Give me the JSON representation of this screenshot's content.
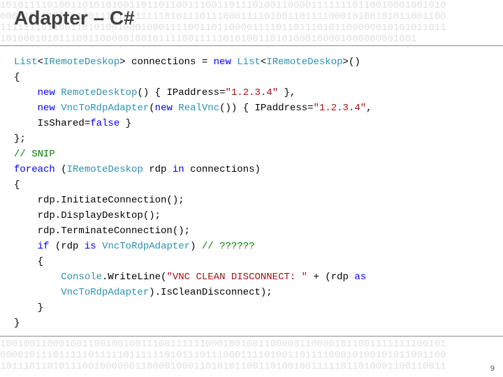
{
  "title": "Adapter – C#",
  "bg_top": "1010111101001101010100110110110011100110111010011000011111110110010001001010\n0000101110111110111110111111010111011100011110100110111100010100101011001100\n1111111011001101010010001000111100110110000111101101110101100000010101011011\n10100010101110011000001001011110011111010100110101000100001000000001001",
  "bg_bottom": "1001001100010011001001001110011111100010010011000001100001011001111111100101\n0000101110111110111110111111010111011100011110100110111100010100101011001100\n1011101101011100100000011000010001101010110011010010011111011010001100110011",
  "slide_number": "9",
  "code": [
    [
      {
        "c": "t",
        "v": "List"
      },
      {
        "c": "n",
        "v": "<"
      },
      {
        "c": "t",
        "v": "IRemoteDeskop"
      },
      {
        "c": "n",
        "v": "> connections = "
      },
      {
        "c": "k",
        "v": "new"
      },
      {
        "c": "n",
        "v": " "
      },
      {
        "c": "t",
        "v": "List"
      },
      {
        "c": "n",
        "v": "<"
      },
      {
        "c": "t",
        "v": "IRemoteDeskop"
      },
      {
        "c": "n",
        "v": ">()"
      }
    ],
    [
      {
        "c": "n",
        "v": "{"
      }
    ],
    [
      {
        "c": "n",
        "v": "    "
      },
      {
        "c": "k",
        "v": "new"
      },
      {
        "c": "n",
        "v": " "
      },
      {
        "c": "t",
        "v": "RemoteDesktop"
      },
      {
        "c": "n",
        "v": "() { IPaddress="
      },
      {
        "c": "s",
        "v": "\"1.2.3.4\""
      },
      {
        "c": "n",
        "v": " },"
      }
    ],
    [
      {
        "c": "n",
        "v": "    "
      },
      {
        "c": "k",
        "v": "new"
      },
      {
        "c": "n",
        "v": " "
      },
      {
        "c": "t",
        "v": "VncToRdpAdapter"
      },
      {
        "c": "n",
        "v": "("
      },
      {
        "c": "k",
        "v": "new"
      },
      {
        "c": "n",
        "v": " "
      },
      {
        "c": "t",
        "v": "RealVnc"
      },
      {
        "c": "n",
        "v": "()) { IPaddress="
      },
      {
        "c": "s",
        "v": "\"1.2.3.4\""
      },
      {
        "c": "n",
        "v": ","
      }
    ],
    [
      {
        "c": "n",
        "v": "    IsShared="
      },
      {
        "c": "k",
        "v": "false"
      },
      {
        "c": "n",
        "v": " }"
      }
    ],
    [
      {
        "c": "n",
        "v": "};"
      }
    ],
    [
      {
        "c": "c",
        "v": "// SNIP"
      }
    ],
    [
      {
        "c": "k",
        "v": "foreach"
      },
      {
        "c": "n",
        "v": " ("
      },
      {
        "c": "t",
        "v": "IRemoteDeskop"
      },
      {
        "c": "n",
        "v": " rdp "
      },
      {
        "c": "k",
        "v": "in"
      },
      {
        "c": "n",
        "v": " connections)"
      }
    ],
    [
      {
        "c": "n",
        "v": "{"
      }
    ],
    [
      {
        "c": "n",
        "v": "    rdp.InitiateConnection();"
      }
    ],
    [
      {
        "c": "n",
        "v": "    rdp.DisplayDesktop();"
      }
    ],
    [
      {
        "c": "n",
        "v": "    rdp.TerminateConnection();"
      }
    ],
    [
      {
        "c": "n",
        "v": "    "
      },
      {
        "c": "k",
        "v": "if"
      },
      {
        "c": "n",
        "v": " (rdp "
      },
      {
        "c": "k",
        "v": "is"
      },
      {
        "c": "n",
        "v": " "
      },
      {
        "c": "t",
        "v": "VncToRdpAdapter"
      },
      {
        "c": "n",
        "v": ") "
      },
      {
        "c": "c",
        "v": "// ??????"
      }
    ],
    [
      {
        "c": "n",
        "v": "    {"
      }
    ],
    [
      {
        "c": "n",
        "v": "        "
      },
      {
        "c": "t",
        "v": "Console"
      },
      {
        "c": "n",
        "v": ".WriteLine("
      },
      {
        "c": "s",
        "v": "\"VNC CLEAN DISCONNECT: \""
      },
      {
        "c": "n",
        "v": " + (rdp "
      },
      {
        "c": "k",
        "v": "as"
      }
    ],
    [
      {
        "c": "n",
        "v": "        "
      },
      {
        "c": "t",
        "v": "VncToRdpAdapter"
      },
      {
        "c": "n",
        "v": ").IsCleanDisconnect);"
      }
    ],
    [
      {
        "c": "n",
        "v": "    }"
      }
    ],
    [
      {
        "c": "n",
        "v": "}"
      }
    ]
  ]
}
